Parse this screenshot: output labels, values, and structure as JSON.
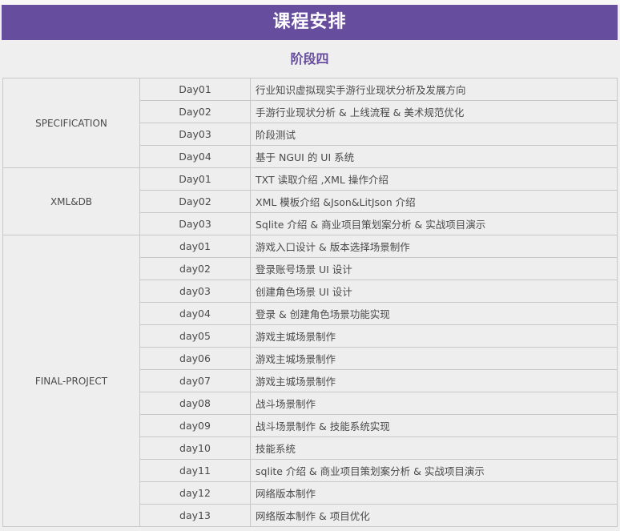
{
  "header": {
    "title": "课程安排",
    "stage": "阶段四"
  },
  "sections": [
    {
      "name": "SPECIFICATION",
      "rows": [
        {
          "day": "Day01",
          "topic": "行业知识虚拟现实手游行业现状分析及发展方向"
        },
        {
          "day": "Day02",
          "topic": "手游行业现状分析 & 上线流程 & 美术规范优化"
        },
        {
          "day": "Day03",
          "topic": "阶段测试"
        },
        {
          "day": "Day04",
          "topic": "基于 NGUI 的 UI 系统"
        }
      ]
    },
    {
      "name": "XML&DB",
      "rows": [
        {
          "day": "Day01",
          "topic": "TXT 读取介绍 ,XML 操作介绍"
        },
        {
          "day": "Day02",
          "topic": "XML 模板介绍 &Json&LitJson 介绍"
        },
        {
          "day": "Day03",
          "topic": "Sqlite 介绍 & 商业项目策划案分析 & 实战项目演示"
        }
      ]
    },
    {
      "name": "FINAL-PROJECT",
      "rows": [
        {
          "day": "day01",
          "topic": "游戏入口设计 & 版本选择场景制作"
        },
        {
          "day": "day02",
          "topic": "登录账号场景 UI 设计"
        },
        {
          "day": "day03",
          "topic": "创建角色场景 UI 设计"
        },
        {
          "day": "day04",
          "topic": "登录 & 创建角色场景功能实现"
        },
        {
          "day": "day05",
          "topic": "游戏主城场景制作"
        },
        {
          "day": "day06",
          "topic": "游戏主城场景制作"
        },
        {
          "day": "day07",
          "topic": "游戏主城场景制作"
        },
        {
          "day": "day08",
          "topic": "战斗场景制作"
        },
        {
          "day": "day09",
          "topic": "战斗场景制作 & 技能系统实现"
        },
        {
          "day": "day10",
          "topic": "技能系统"
        },
        {
          "day": "day11",
          "topic": "sqlite 介绍 & 商业项目策划案分析 & 实战项目演示"
        },
        {
          "day": "day12",
          "topic": "网络版本制作"
        },
        {
          "day": "day13",
          "topic": "网络版本制作 & 项目优化"
        }
      ]
    }
  ]
}
